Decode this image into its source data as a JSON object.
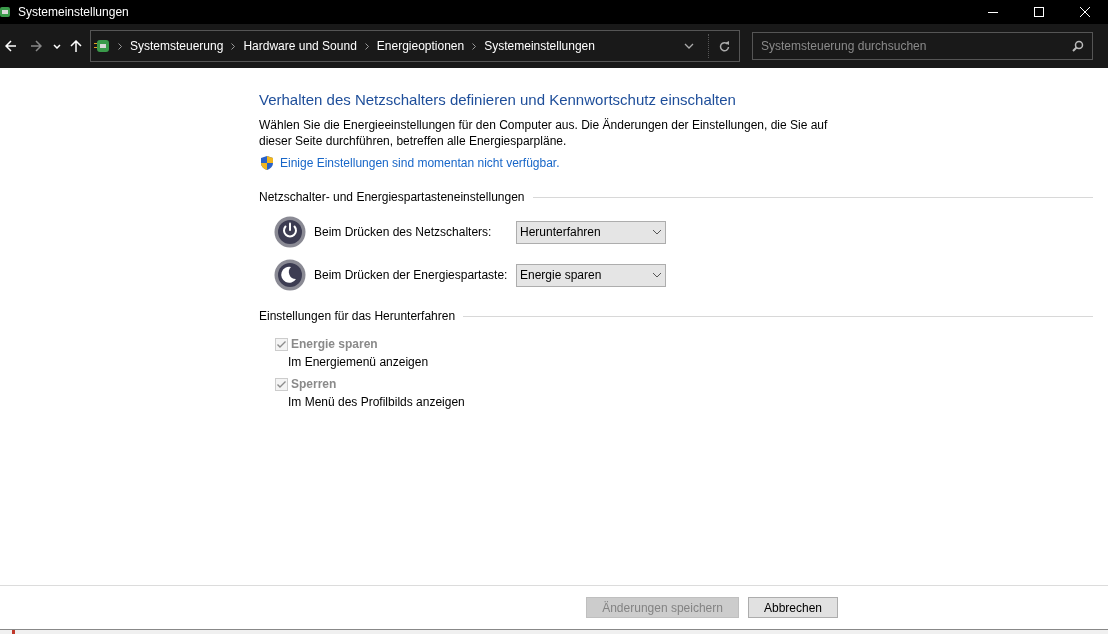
{
  "window": {
    "title": "Systemeinstellungen"
  },
  "breadcrumb": [
    "Systemsteuerung",
    "Hardware und Sound",
    "Energieoptionen",
    "Systemeinstellungen"
  ],
  "search": {
    "placeholder": "Systemsteuerung durchsuchen"
  },
  "heading": "Verhalten des Netzschalters definieren und Kennwortschutz einschalten",
  "description": "Wählen Sie die Energieeinstellungen für den Computer aus. Die Änderungen der Einstellungen, die Sie auf dieser Seite durchführen, betreffen alle Energiesparpläne.",
  "admin_link": "Einige Einstellungen sind momentan nicht verfügbar.",
  "button_section": {
    "title": "Netzschalter- und Energiespartasteneinstellungen",
    "rows": [
      {
        "kind": "power",
        "label": "Beim Drücken des Netzschalters:",
        "value": "Herunterfahren"
      },
      {
        "kind": "sleep",
        "label": "Beim Drücken der Energiespartaste:",
        "value": "Energie sparen"
      }
    ]
  },
  "shutdown_section": {
    "title": "Einstellungen für das Herunterfahren",
    "options": [
      {
        "label": "Energie sparen",
        "description": "Im Energiemenü anzeigen",
        "checked": true,
        "disabled": true
      },
      {
        "label": "Sperren",
        "description": "Im Menü des Profilbilds anzeigen",
        "checked": true,
        "disabled": true
      }
    ]
  },
  "buttons": [
    {
      "label": "Änderungen speichern",
      "disabled": true
    },
    {
      "label": "Abbrechen",
      "disabled": false
    }
  ]
}
